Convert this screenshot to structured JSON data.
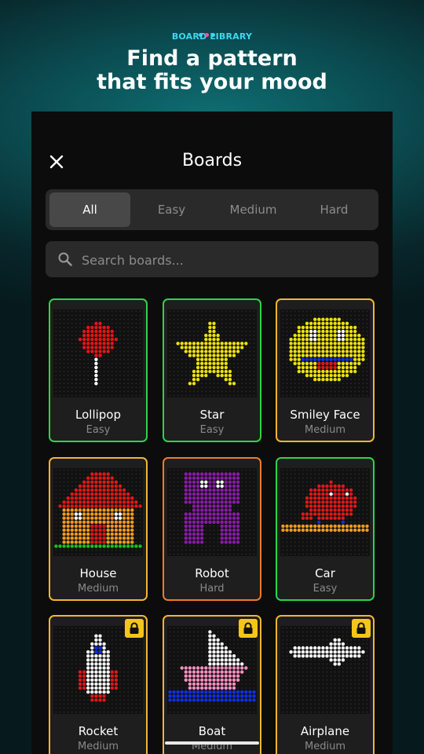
{
  "header": {
    "brand": "BOARD LIBRARY",
    "headline_line1": "Find a pattern",
    "headline_line2": "that fits your mood"
  },
  "panel": {
    "title": "Boards",
    "tabs": [
      "All",
      "Easy",
      "Medium",
      "Hard"
    ],
    "active_tab": "All",
    "search_placeholder": "Search boards..."
  },
  "boards": [
    {
      "name": "Lollipop",
      "difficulty": "Easy",
      "locked": false
    },
    {
      "name": "Star",
      "difficulty": "Easy",
      "locked": false
    },
    {
      "name": "Smiley Face",
      "difficulty": "Medium",
      "locked": false
    },
    {
      "name": "House",
      "difficulty": "Medium",
      "locked": false
    },
    {
      "name": "Robot",
      "difficulty": "Hard",
      "locked": false
    },
    {
      "name": "Car",
      "difficulty": "Easy",
      "locked": false
    },
    {
      "name": "Rocket",
      "difficulty": "Medium",
      "locked": true
    },
    {
      "name": "Boat",
      "difficulty": "Medium",
      "locked": true
    },
    {
      "name": "Airplane",
      "difficulty": "Medium",
      "locked": true
    }
  ],
  "colors": {
    "easy": "#2ed34a",
    "medium": "#f2b630",
    "hard": "#f07a2a",
    "lock": "#f5c518"
  },
  "icons": {
    "close": "close-icon",
    "search": "search-icon",
    "lock": "lock-icon"
  }
}
